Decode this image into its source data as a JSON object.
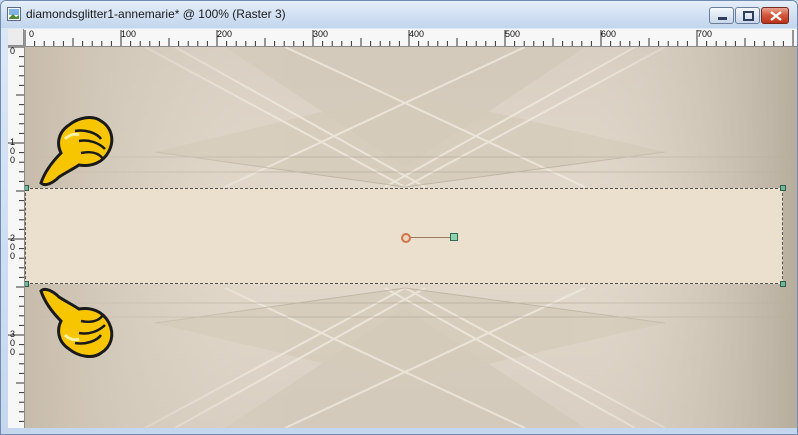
{
  "window": {
    "title": "diamondsglitter1-annemarie* @ 100% (Raster 3)"
  },
  "controls": {
    "minimize": "minimize",
    "maximize": "maximize",
    "close": "close"
  },
  "ruler_top": {
    "labels": [
      "0",
      "100",
      "200",
      "300",
      "400",
      "500",
      "600",
      "700"
    ]
  },
  "ruler_left": {
    "labels": [
      "0",
      "100",
      "200",
      "300"
    ]
  },
  "icons": {
    "app": "psp-image-icon",
    "pointer_up": "pointing-hand-down-icon",
    "pointer_down": "pointing-hand-up-icon"
  },
  "colors": {
    "canvas_bg": "#ddd3c4",
    "selection_fill": "#ebdfcd",
    "handle": "#6fb89a",
    "hand_yellow": "#f7c600"
  }
}
